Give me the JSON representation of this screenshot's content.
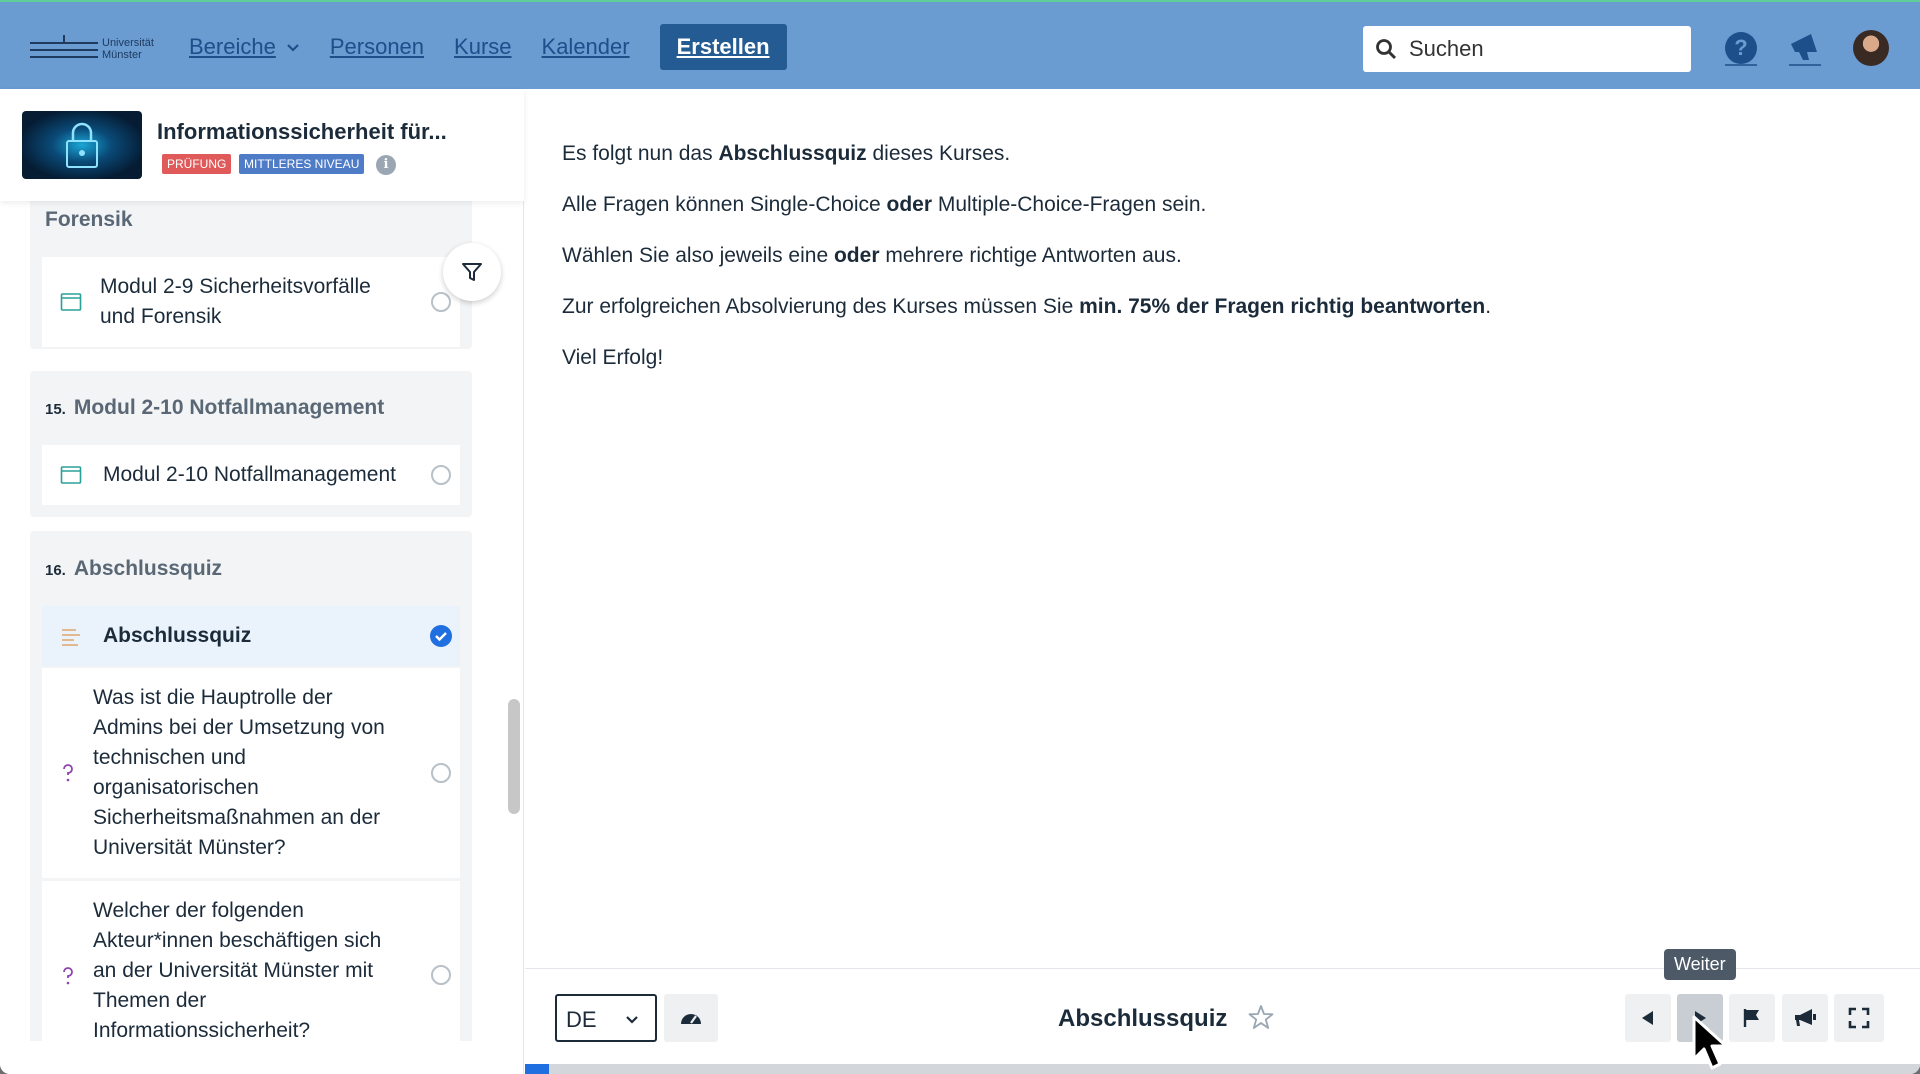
{
  "header": {
    "logo_text_1": "Universität",
    "logo_text_2": "Münster",
    "nav": [
      "Bereiche",
      "Personen",
      "Kurse",
      "Kalender"
    ],
    "create_label": "Erstellen",
    "search_placeholder": "Suchen",
    "help_icon": "question-circle-icon",
    "notifications_icon": "megaphone-icon",
    "accent": "#6a9bd1"
  },
  "course": {
    "title": "Informationssicherheit für...",
    "badges": [
      "PRÜFUNG",
      "MITTLERES NIVEAU"
    ],
    "info_icon": "i"
  },
  "sidebar": {
    "sections": [
      {
        "title": "Forensik",
        "items": [
          {
            "label_line1": "Modul 2-9 Sicherheitsvorfälle",
            "label_line2": "und Forensik",
            "icon": "module-icon",
            "status": "open"
          }
        ]
      },
      {
        "number": "15.",
        "title": "Modul 2-10 Notfallmanagement",
        "items": [
          {
            "label": "Modul 2-10 Notfallmanagement",
            "icon": "module-icon",
            "status": "open"
          }
        ]
      },
      {
        "number": "16.",
        "title": "Abschlussquiz",
        "items": [
          {
            "label": "Abschlussquiz",
            "icon": "text-lines-icon",
            "status": "completed",
            "active": true
          },
          {
            "lines": [
              "Was ist die Hauptrolle der",
              "Admins bei der Umsetzung von",
              "technischen und",
              "organisatorischen",
              "Sicherheitsmaßnahmen an der",
              "Universität Münster?"
            ],
            "icon": "question-icon",
            "status": "open"
          },
          {
            "lines": [
              "Welcher der folgenden",
              "Akteur*innen beschäftigen sich",
              "an der Universität Münster mit",
              "Themen der",
              "Informationssicherheit?"
            ],
            "icon": "question-icon",
            "status": "open"
          }
        ]
      }
    ]
  },
  "content": {
    "p1": {
      "a": "Es folgt nun das ",
      "b": "Abschlussquiz",
      "c": " dieses Kurses."
    },
    "p2": {
      "a": "Alle Fragen können Single-Choice ",
      "b": "oder",
      "c": " Multiple-Choice-Fragen sein."
    },
    "p3": {
      "a": "Wählen Sie also jeweils eine ",
      "b": "oder",
      "c": " mehrere richtige Antworten aus."
    },
    "p4": {
      "a": "Zur erfolgreichen Absolvierung des Kurses müssen Sie ",
      "b": "min. 75% der Fragen richtig beantworten",
      "c": "."
    },
    "p5": "Viel Erfolg!"
  },
  "footer": {
    "language": "DE",
    "title": "Abschlussquiz",
    "tooltip": "Weiter",
    "progress": 0.017
  }
}
